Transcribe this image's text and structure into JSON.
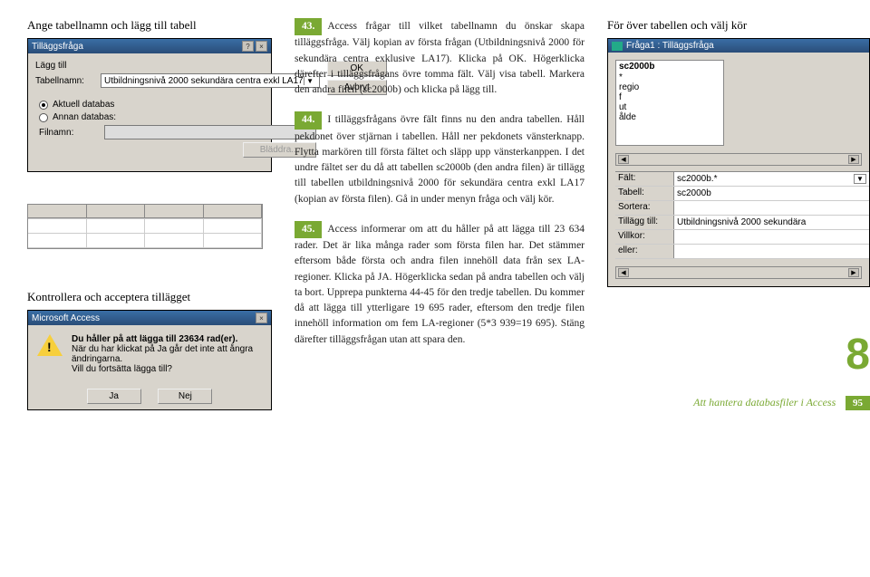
{
  "headings": {
    "left1": "Ange tabellnamn och lägg till tabell",
    "left2": "Kontrollera och acceptera tillägget",
    "right1": "För över tabellen och välj kör"
  },
  "steps": {
    "s43": {
      "num": "43.",
      "text": "Access frågar till vilket tabellnamn du önskar skapa tilläggsfråga. Välj kopian av första frågan (Utbildningsnivå 2000 för sekundära centra exklusive LA17). Klicka på OK. Högerklicka därefter i tilläggsfrågans övre tomma fält. Välj visa tabell. Markera den andra filen (sc2000b) och klicka på lägg till."
    },
    "s44": {
      "num": "44.",
      "text": "I tilläggsfrågans övre fält finns nu den andra tabellen. Håll pekdonet över stjärnan i tabellen. Håll ner pekdonets vänsterknapp. Flytta markören till första fältet och släpp upp vänsterkanppen. I det undre fältet ser du då att tabellen sc2000b (den andra filen) är tillägg till tabellen utbildningsnivå 2000 för sekundära centra exkl LA17 (kopian av första filen). Gå in under menyn fråga och välj kör."
    },
    "s45": {
      "num": "45.",
      "text": "Access informerar om att du håller på att lägga till 23 634 rader. Det är lika många rader som första filen har. Det stämmer eftersom både första och andra filen innehöll data från sex LA-regioner. Klicka på JA. Högerklicka sedan på andra tabellen och välj ta bort. Upprepa punkterna 44-45 för den tredje tabellen. Du kommer då att lägga till ytterligare 19 695 rader, eftersom den tredje filen innehöll information om fem LA-regioner (5*3 939=19 695). Stäng därefter tilläggsfrågan utan att spara den."
    }
  },
  "dlg_append": {
    "title": "Tilläggsfråga",
    "lbl_append": "Lägg till",
    "lbl_table": "Tabellnamn:",
    "table_value": "Utbildningsnivå 2000 sekundära centra exkl LA17",
    "radio1": "Aktuell databas",
    "radio2": "Annan databas:",
    "lbl_file": "Filnamn:",
    "btn_browse": "Bläddra...",
    "btn_ok": "OK",
    "btn_cancel": "Avbryt"
  },
  "dlg_alert": {
    "title": "Microsoft Access",
    "line1": "Du håller på att lägga till 23634 rad(er).",
    "line2": "När du har klickat på Ja går det inte att ångra ändringarna.",
    "line3": "Vill du fortsätta lägga till?",
    "btn_yes": "Ja",
    "btn_no": "Nej"
  },
  "dlg_query": {
    "title": "Fråga1 : Tilläggsfråga",
    "list": {
      "hd": "sc2000b",
      "items": [
        "*",
        "regio",
        "f",
        "ut",
        "ålde"
      ]
    },
    "rows": {
      "field_lbl": "Fält:",
      "field_val": "sc2000b.*",
      "table_lbl": "Tabell:",
      "table_val": "sc2000b",
      "sort_lbl": "Sortera:",
      "append_lbl": "Tillägg till:",
      "append_val": "Utbildningsnivå 2000 sekundära",
      "crit_lbl": "Villkor:",
      "or_lbl": "eller:"
    }
  },
  "footer": {
    "bignum": "8",
    "category": "Att hantera databasfiler i Access",
    "page": "95"
  }
}
